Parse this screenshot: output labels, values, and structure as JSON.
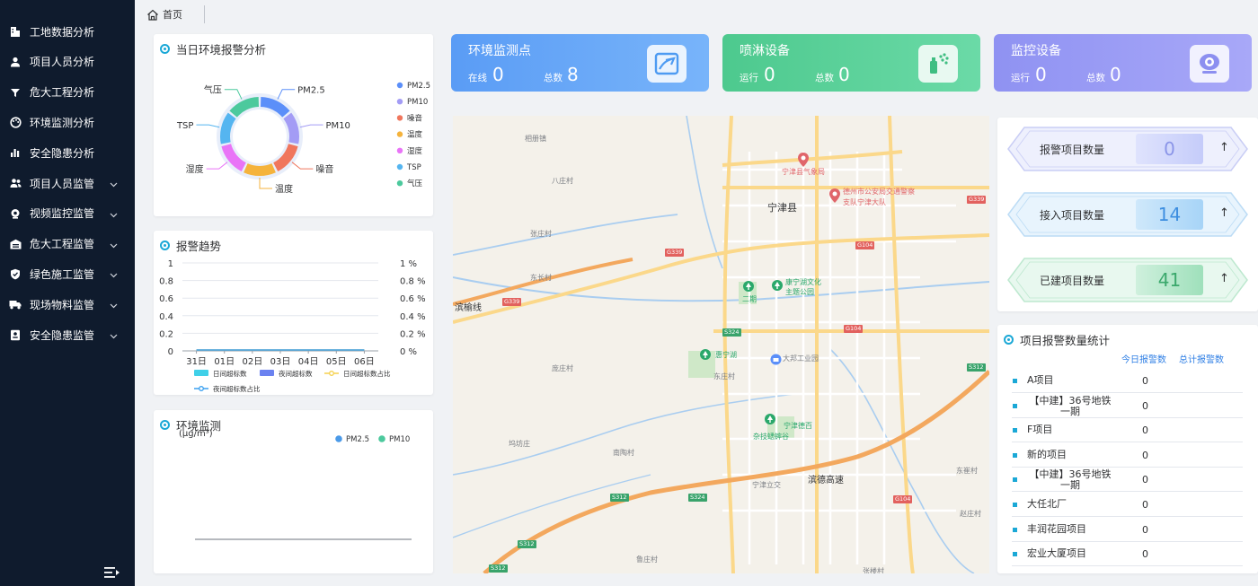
{
  "sidebar": {
    "items": [
      {
        "label": "工地数据分析",
        "icon": "building-icon",
        "expandable": false
      },
      {
        "label": "项目人员分析",
        "icon": "user-icon",
        "expandable": false
      },
      {
        "label": "危大工程分析",
        "icon": "filter-icon",
        "expandable": false
      },
      {
        "label": "环境监测分析",
        "icon": "palette-icon",
        "expandable": false
      },
      {
        "label": "安全隐患分析",
        "icon": "bar-chart-icon",
        "expandable": false
      },
      {
        "label": "项目人员监管",
        "icon": "users-icon",
        "expandable": true
      },
      {
        "label": "视频监控监管",
        "icon": "camera-icon",
        "expandable": true
      },
      {
        "label": "危大工程监管",
        "icon": "warehouse-icon",
        "expandable": true
      },
      {
        "label": "绿色施工监管",
        "icon": "shield-icon",
        "expandable": true
      },
      {
        "label": "现场物料监管",
        "icon": "truck-icon",
        "expandable": true
      },
      {
        "label": "安全隐患监管",
        "icon": "badge-icon",
        "expandable": true
      }
    ]
  },
  "tabs": {
    "home": "首页"
  },
  "panels": {
    "alarm_pie_title": "当日环境报警分析",
    "trend_title": "报警趋势",
    "env_title": "环境监测",
    "env_unit": "(μg/m³)",
    "table_title": "项目报警数量统计"
  },
  "cards": [
    {
      "title": "环境监测点",
      "label1": "在线",
      "value1": "0",
      "label2": "总数",
      "value2": "8",
      "icon": "monitor-point-icon"
    },
    {
      "title": "喷淋设备",
      "label1": "运行",
      "value1": "0",
      "label2": "总数",
      "value2": "0",
      "icon": "sprinkler-icon"
    },
    {
      "title": "监控设备",
      "label1": "运行",
      "value1": "0",
      "label2": "总数",
      "value2": "0",
      "icon": "webcam-icon"
    }
  ],
  "stats": [
    {
      "label": "报警项目数量",
      "value": "0",
      "arrow": "↑"
    },
    {
      "label": "接入项目数量",
      "value": "14",
      "arrow": "↑"
    },
    {
      "label": "已建项目数量",
      "value": "41",
      "arrow": "↑"
    }
  ],
  "table": {
    "headers": [
      "今日报警数",
      "总计报警数"
    ],
    "rows": [
      {
        "name": "A项目",
        "today": "0"
      },
      {
        "name": "【中建】36号地铁一期",
        "today": "0"
      },
      {
        "name": "F项目",
        "today": "0"
      },
      {
        "name": "新的项目",
        "today": "0"
      },
      {
        "name": "【中建】36号地铁一期",
        "today": "0"
      },
      {
        "name": "大任北厂",
        "today": "0"
      },
      {
        "name": "丰润花园项目",
        "today": "0"
      },
      {
        "name": "宏业大厦项目",
        "today": "0"
      }
    ]
  },
  "map": {
    "labels": [
      "相册镇",
      "宁津县气象局",
      "德州市公安局交通警察",
      "支队宁津大队",
      "宁津县",
      "八庄村",
      "张庄村",
      "东长村",
      "滨榆线",
      "康宁湖文化",
      "主题公园",
      "二期",
      "惠宁湖",
      "大邦工业园",
      "庞庄村",
      "宁津德百",
      "杂技蟋蟀谷",
      "坞坊庄",
      "南陶村",
      "滨德高速",
      "宁津立交",
      "东庄村",
      "赵庄村",
      "鲁庄村",
      "张楼村",
      "东崔村"
    ],
    "shields": [
      "G339",
      "G339",
      "G104",
      "G339",
      "G104",
      "S324",
      "S324",
      "S312",
      "S312",
      "G104",
      "S312",
      "S312"
    ]
  },
  "chart_data": [
    {
      "type": "pie",
      "title": "当日环境报警分析",
      "labels": [
        "PM2.5",
        "PM10",
        "噪音",
        "温度",
        "湿度",
        "TSP",
        "气压"
      ],
      "values": [
        1,
        1,
        1,
        1,
        1,
        1,
        1
      ],
      "colors": [
        "#5b8ff9",
        "#a39cf5",
        "#f0765d",
        "#f5b33c",
        "#e974f7",
        "#55b5f0",
        "#4cc99d"
      ],
      "legend": "right"
    },
    {
      "type": "bar",
      "title": "报警趋势",
      "categories": [
        "31日",
        "01日",
        "02日",
        "03日",
        "04日",
        "05日",
        "06日"
      ],
      "y_left_ticks": [
        "0",
        "0.2",
        "0.4",
        "0.6",
        "0.8",
        "1"
      ],
      "y_right_ticks": [
        "0 %",
        "0.2 %",
        "0.4 %",
        "0.6 %",
        "0.8 %",
        "1 %"
      ],
      "ylim": [
        0,
        1
      ],
      "series": [
        {
          "name": "日间超标数",
          "type": "bar",
          "color": "#40d0e8",
          "values": [
            0,
            0,
            0,
            0,
            0,
            0,
            0
          ]
        },
        {
          "name": "夜间超标数",
          "type": "bar",
          "color": "#6b82f0",
          "values": [
            0,
            0,
            0,
            0,
            0,
            0,
            0
          ]
        },
        {
          "name": "日间超标数占比",
          "type": "line",
          "color": "#f5d14e",
          "values": [
            0,
            0,
            0,
            0,
            0,
            0,
            0
          ]
        },
        {
          "name": "夜间超标数占比",
          "type": "line",
          "color": "#3aa0f0",
          "values": [
            0,
            0,
            0,
            0,
            0,
            0,
            0
          ]
        }
      ]
    },
    {
      "type": "line",
      "title": "环境监测",
      "ylabel": "(μg/m³)",
      "series": [
        {
          "name": "PM2.5",
          "color": "#4b9ae8",
          "values": []
        },
        {
          "name": "PM10",
          "color": "#4cc99d",
          "values": []
        }
      ]
    }
  ]
}
